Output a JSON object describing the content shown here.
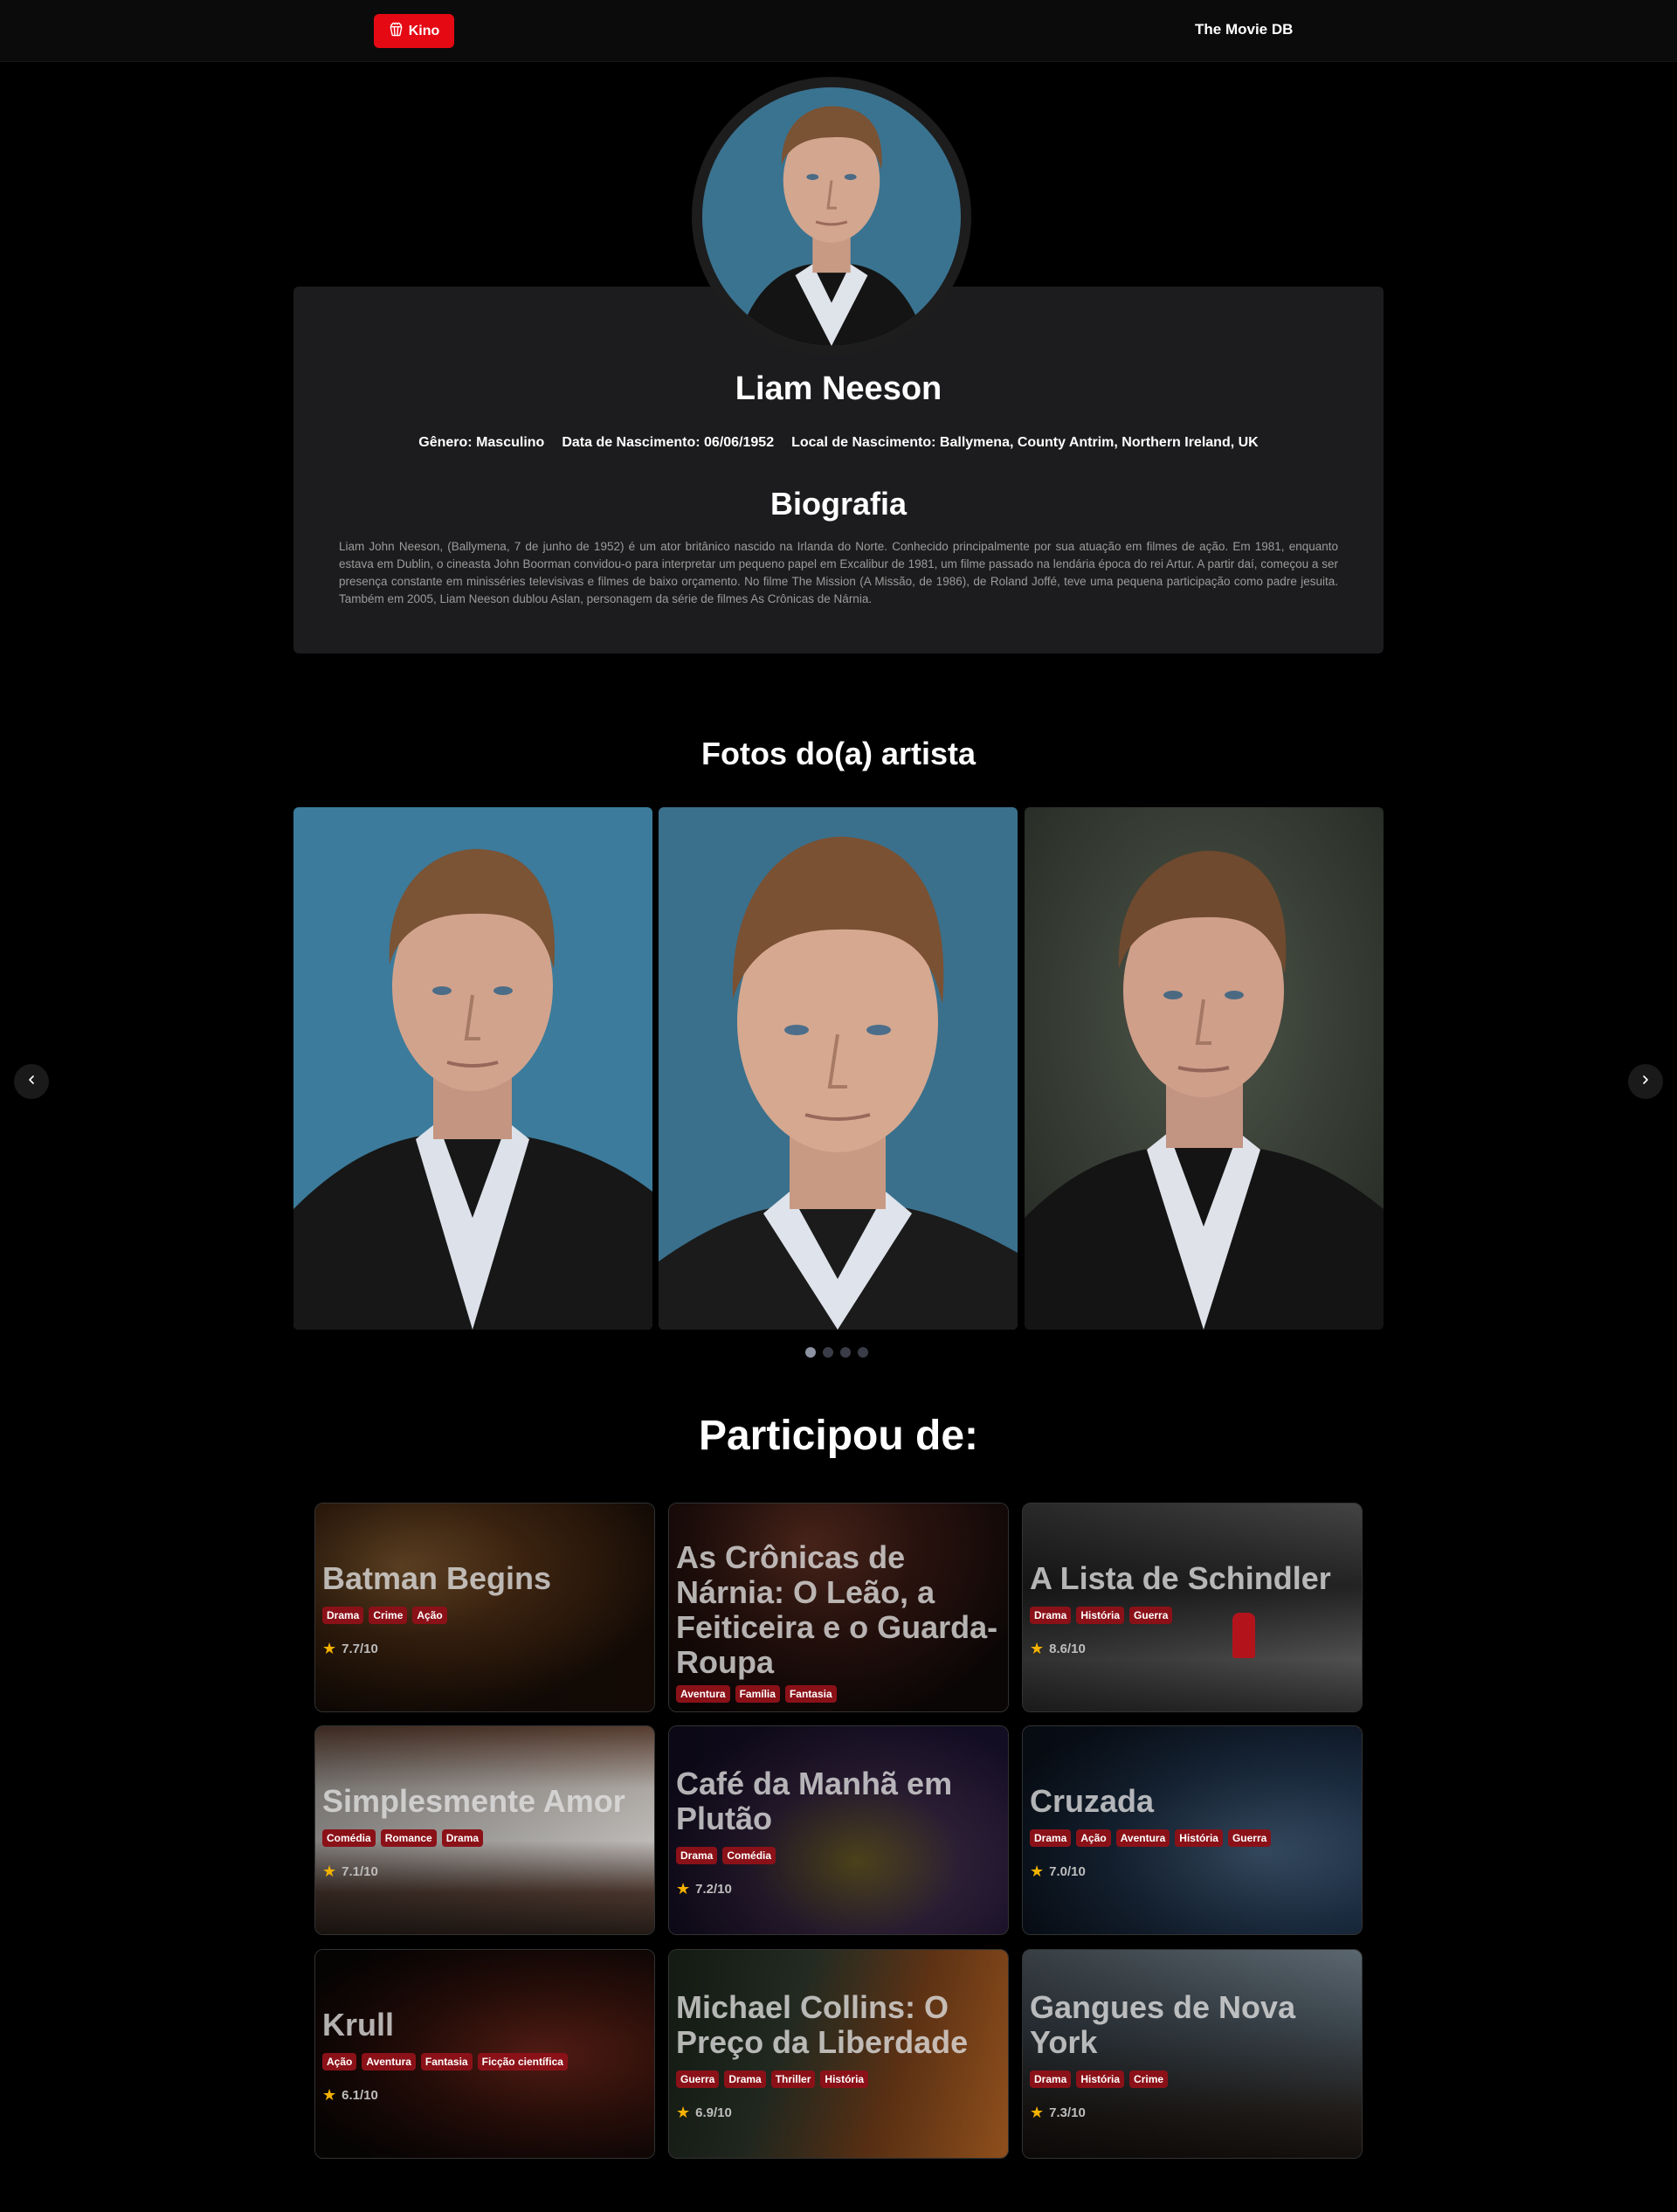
{
  "header": {
    "logo_label": "Kino",
    "brand_link": "The Movie DB"
  },
  "person": {
    "name": "Liam Neeson",
    "gender": "Gênero: Masculino",
    "birthday": "Data de Nascimento: 06/06/1952",
    "birthplace": "Local de Nascimento: Ballymena, County Antrim, Northern Ireland, UK",
    "bio_title": "Biografia",
    "bio": "Liam John Neeson, (Ballymena, 7 de junho de 1952) é um ator britânico nascido na Irlanda do Norte. Conhecido principalmente por sua atuação em filmes de ação. Em 1981, enquanto estava em Dublin, o cineasta John Boorman convidou-o para interpretar um pequeno papel em Excalibur de 1981, um filme passado na lendária época do rei Artur. A partir daí, começou a ser presença constante em minisséries televisivas e filmes de baixo orçamento. No filme The Mission (A Missão, de 1986), de Roland Joffé, teve uma pequena participação como padre jesuita. Também em 2005, Liam Neeson dublou Aslan, personagem da série de filmes As Crônicas de Nárnia."
  },
  "photos": {
    "title": "Fotos do(a) artista",
    "slides": 4,
    "active_slide": 1
  },
  "films": {
    "title": "Participou de:",
    "items": [
      {
        "title": "Batman Begins",
        "genres": [
          "Drama",
          "Crime",
          "Ação"
        ],
        "rating": "7.7/10"
      },
      {
        "title": "As Crônicas de Nárnia: O Leão, a Feiticeira e o Guarda-Roupa",
        "genres": [
          "Aventura",
          "Família",
          "Fantasia"
        ],
        "rating": ""
      },
      {
        "title": "A Lista de Schindler",
        "genres": [
          "Drama",
          "História",
          "Guerra"
        ],
        "rating": "8.6/10"
      },
      {
        "title": "Simplesmente Amor",
        "genres": [
          "Comédia",
          "Romance",
          "Drama"
        ],
        "rating": "7.1/10"
      },
      {
        "title": "Café da Manhã em Plutão",
        "genres": [
          "Drama",
          "Comédia"
        ],
        "rating": "7.2/10"
      },
      {
        "title": "Cruzada",
        "genres": [
          "Drama",
          "Ação",
          "Aventura",
          "História",
          "Guerra"
        ],
        "rating": "7.0/10"
      },
      {
        "title": "Krull",
        "genres": [
          "Ação",
          "Aventura",
          "Fantasia",
          "Ficção científica"
        ],
        "rating": "6.1/10"
      },
      {
        "title": "Michael Collins: O Preço da Liberdade",
        "genres": [
          "Guerra",
          "Drama",
          "Thriller",
          "História"
        ],
        "rating": "6.9/10"
      },
      {
        "title": "Gangues de Nova York",
        "genres": [
          "Drama",
          "História",
          "Crime"
        ],
        "rating": "7.3/10"
      }
    ]
  },
  "icons": {
    "logo": "popcorn-icon",
    "prev": "chevron-left-icon",
    "next": "chevron-right-icon",
    "rating": "star-icon"
  },
  "colors": {
    "accent": "#e50914",
    "genre_tag": "#8b1118",
    "card": "#1c1c1e",
    "star": "#f5b301"
  }
}
